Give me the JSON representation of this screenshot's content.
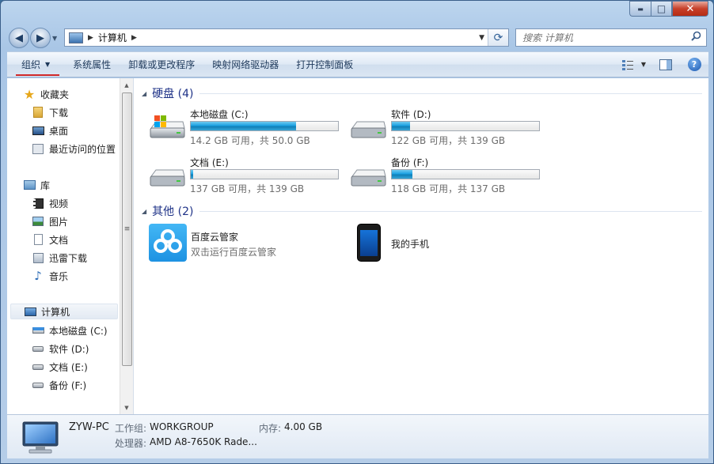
{
  "window": {
    "caption": {
      "minimize": "▬",
      "maximize": "□",
      "close": "✕"
    }
  },
  "nav": {
    "back": "◀",
    "forward": "▶",
    "dropdown": "▼"
  },
  "address": {
    "separator": "▶",
    "location": "计算机",
    "separator2": "▶",
    "dropdown": "▼",
    "refresh": "⟳"
  },
  "search": {
    "placeholder": "搜索 计算机",
    "icon": "search-icon"
  },
  "toolbar": {
    "organize": "组织",
    "organize_caret": "▼",
    "items": [
      "系统属性",
      "卸载或更改程序",
      "映射网络驱动器",
      "打开控制面板"
    ],
    "view_caret": "▼",
    "help": "?"
  },
  "sidebar": {
    "favorites": {
      "label": "收藏夹",
      "items": [
        "下载",
        "桌面",
        "最近访问的位置"
      ]
    },
    "libraries": {
      "label": "库",
      "items": [
        "视频",
        "图片",
        "文档",
        "迅雷下载",
        "音乐"
      ]
    },
    "computer": {
      "label": "计算机",
      "items": [
        "本地磁盘 (C:)",
        "软件 (D:)",
        "文档 (E:)",
        "备份 (F:)"
      ]
    },
    "scroll": {
      "up": "▲",
      "down": "▼",
      "grip": "≡"
    }
  },
  "content": {
    "hard_disks": {
      "header": "硬盘 (4)",
      "collapse_icon": "◢",
      "drives": [
        {
          "name": "本地磁盘 (C:)",
          "info": "14.2 GB 可用，共 50.0 GB",
          "used_fraction": 0.716,
          "accent": "#1ba1e2"
        },
        {
          "name": "软件 (D:)",
          "info": "122 GB 可用，共 139 GB",
          "used_fraction": 0.122,
          "accent": "#1ba1e2"
        },
        {
          "name": "文档 (E:)",
          "info": "137 GB 可用，共 139 GB",
          "used_fraction": 0.014,
          "accent": "#1ba1e2"
        },
        {
          "name": "备份 (F:)",
          "info": "118 GB 可用，共 137 GB",
          "used_fraction": 0.139,
          "accent": "#1ba1e2"
        }
      ]
    },
    "other": {
      "header": "其他 (2)",
      "collapse_icon": "◢",
      "items": [
        {
          "name": "百度云管家",
          "desc": "双击运行百度云管家"
        },
        {
          "name": "我的手机",
          "desc": ""
        }
      ]
    }
  },
  "details": {
    "pc_name": "ZYW-PC",
    "workgroup_label": "工作组:",
    "workgroup_value": "WORKGROUP",
    "memory_label": "内存:",
    "memory_value": "4.00 GB",
    "processor_label": "处理器:",
    "processor_value": "AMD A8-7650K Rade..."
  }
}
